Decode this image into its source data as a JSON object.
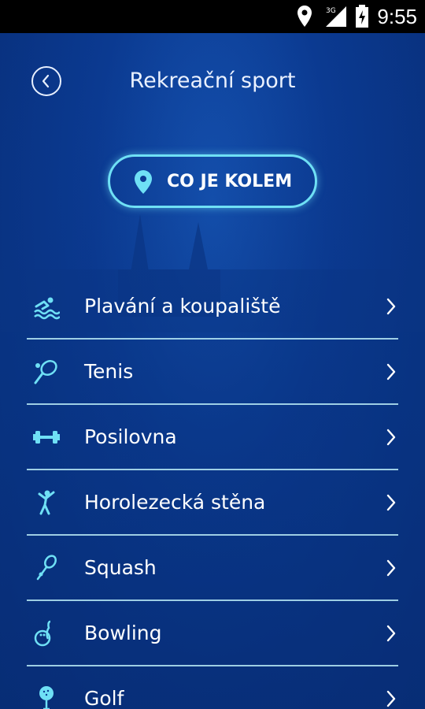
{
  "status_bar": {
    "time": "9:55",
    "network": "3G",
    "icons": [
      "location-icon",
      "signal-icon",
      "battery-icon"
    ]
  },
  "header": {
    "title": "Rekreační sport",
    "back_icon": "chevron-left-icon"
  },
  "near_button": {
    "label": "CO JE KOLEM",
    "icon": "location-pin-icon"
  },
  "list": {
    "items": [
      {
        "label": "Plavání a koupaliště",
        "icon": "swimming-icon"
      },
      {
        "label": "Tenis",
        "icon": "tennis-icon"
      },
      {
        "label": "Posilovna",
        "icon": "dumbbell-icon"
      },
      {
        "label": "Horolezecká stěna",
        "icon": "climbing-icon"
      },
      {
        "label": "Squash",
        "icon": "squash-icon"
      },
      {
        "label": "Bowling",
        "icon": "bowling-icon"
      },
      {
        "label": "Golf",
        "icon": "golf-icon"
      }
    ]
  },
  "colors": {
    "background": "#0b3a91",
    "accent": "#6fe0f5",
    "text": "#ffffff",
    "status_bar": "#000000"
  }
}
